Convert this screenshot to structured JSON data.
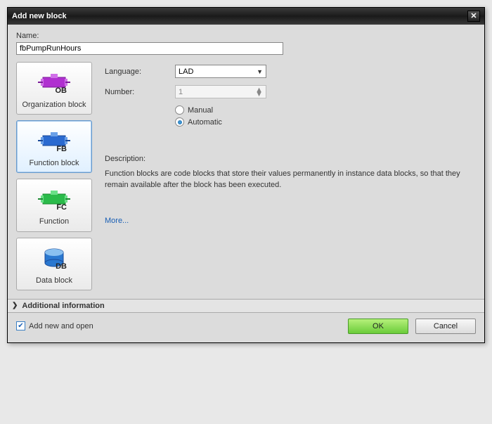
{
  "titlebar": {
    "title": "Add new block"
  },
  "name": {
    "label": "Name:",
    "value": "fbPumpRunHours"
  },
  "blockTypes": [
    {
      "id": "ob",
      "label": "Organization block",
      "badge": "OB",
      "color": "#b030d0"
    },
    {
      "id": "fb",
      "label": "Function block",
      "badge": "FB",
      "color": "#2a6ad0"
    },
    {
      "id": "fc",
      "label": "Function",
      "badge": "FC",
      "color": "#2abb4a"
    },
    {
      "id": "db",
      "label": "Data block",
      "badge": "DB",
      "color": "#2a78d0"
    }
  ],
  "form": {
    "languageLabel": "Language:",
    "languageValue": "LAD",
    "numberLabel": "Number:",
    "numberValue": "1",
    "manualLabel": "Manual",
    "automaticLabel": "Automatic",
    "numberMode": "automatic"
  },
  "description": {
    "title": "Description:",
    "text": "Function blocks are code blocks that store their values permanently in instance data blocks, so that they remain available after the block has been executed."
  },
  "moreLink": "More...",
  "additionalInfo": "Additional  information",
  "footer": {
    "checkboxLabel": "Add new and open",
    "checkboxChecked": true,
    "ok": "OK",
    "cancel": "Cancel"
  }
}
